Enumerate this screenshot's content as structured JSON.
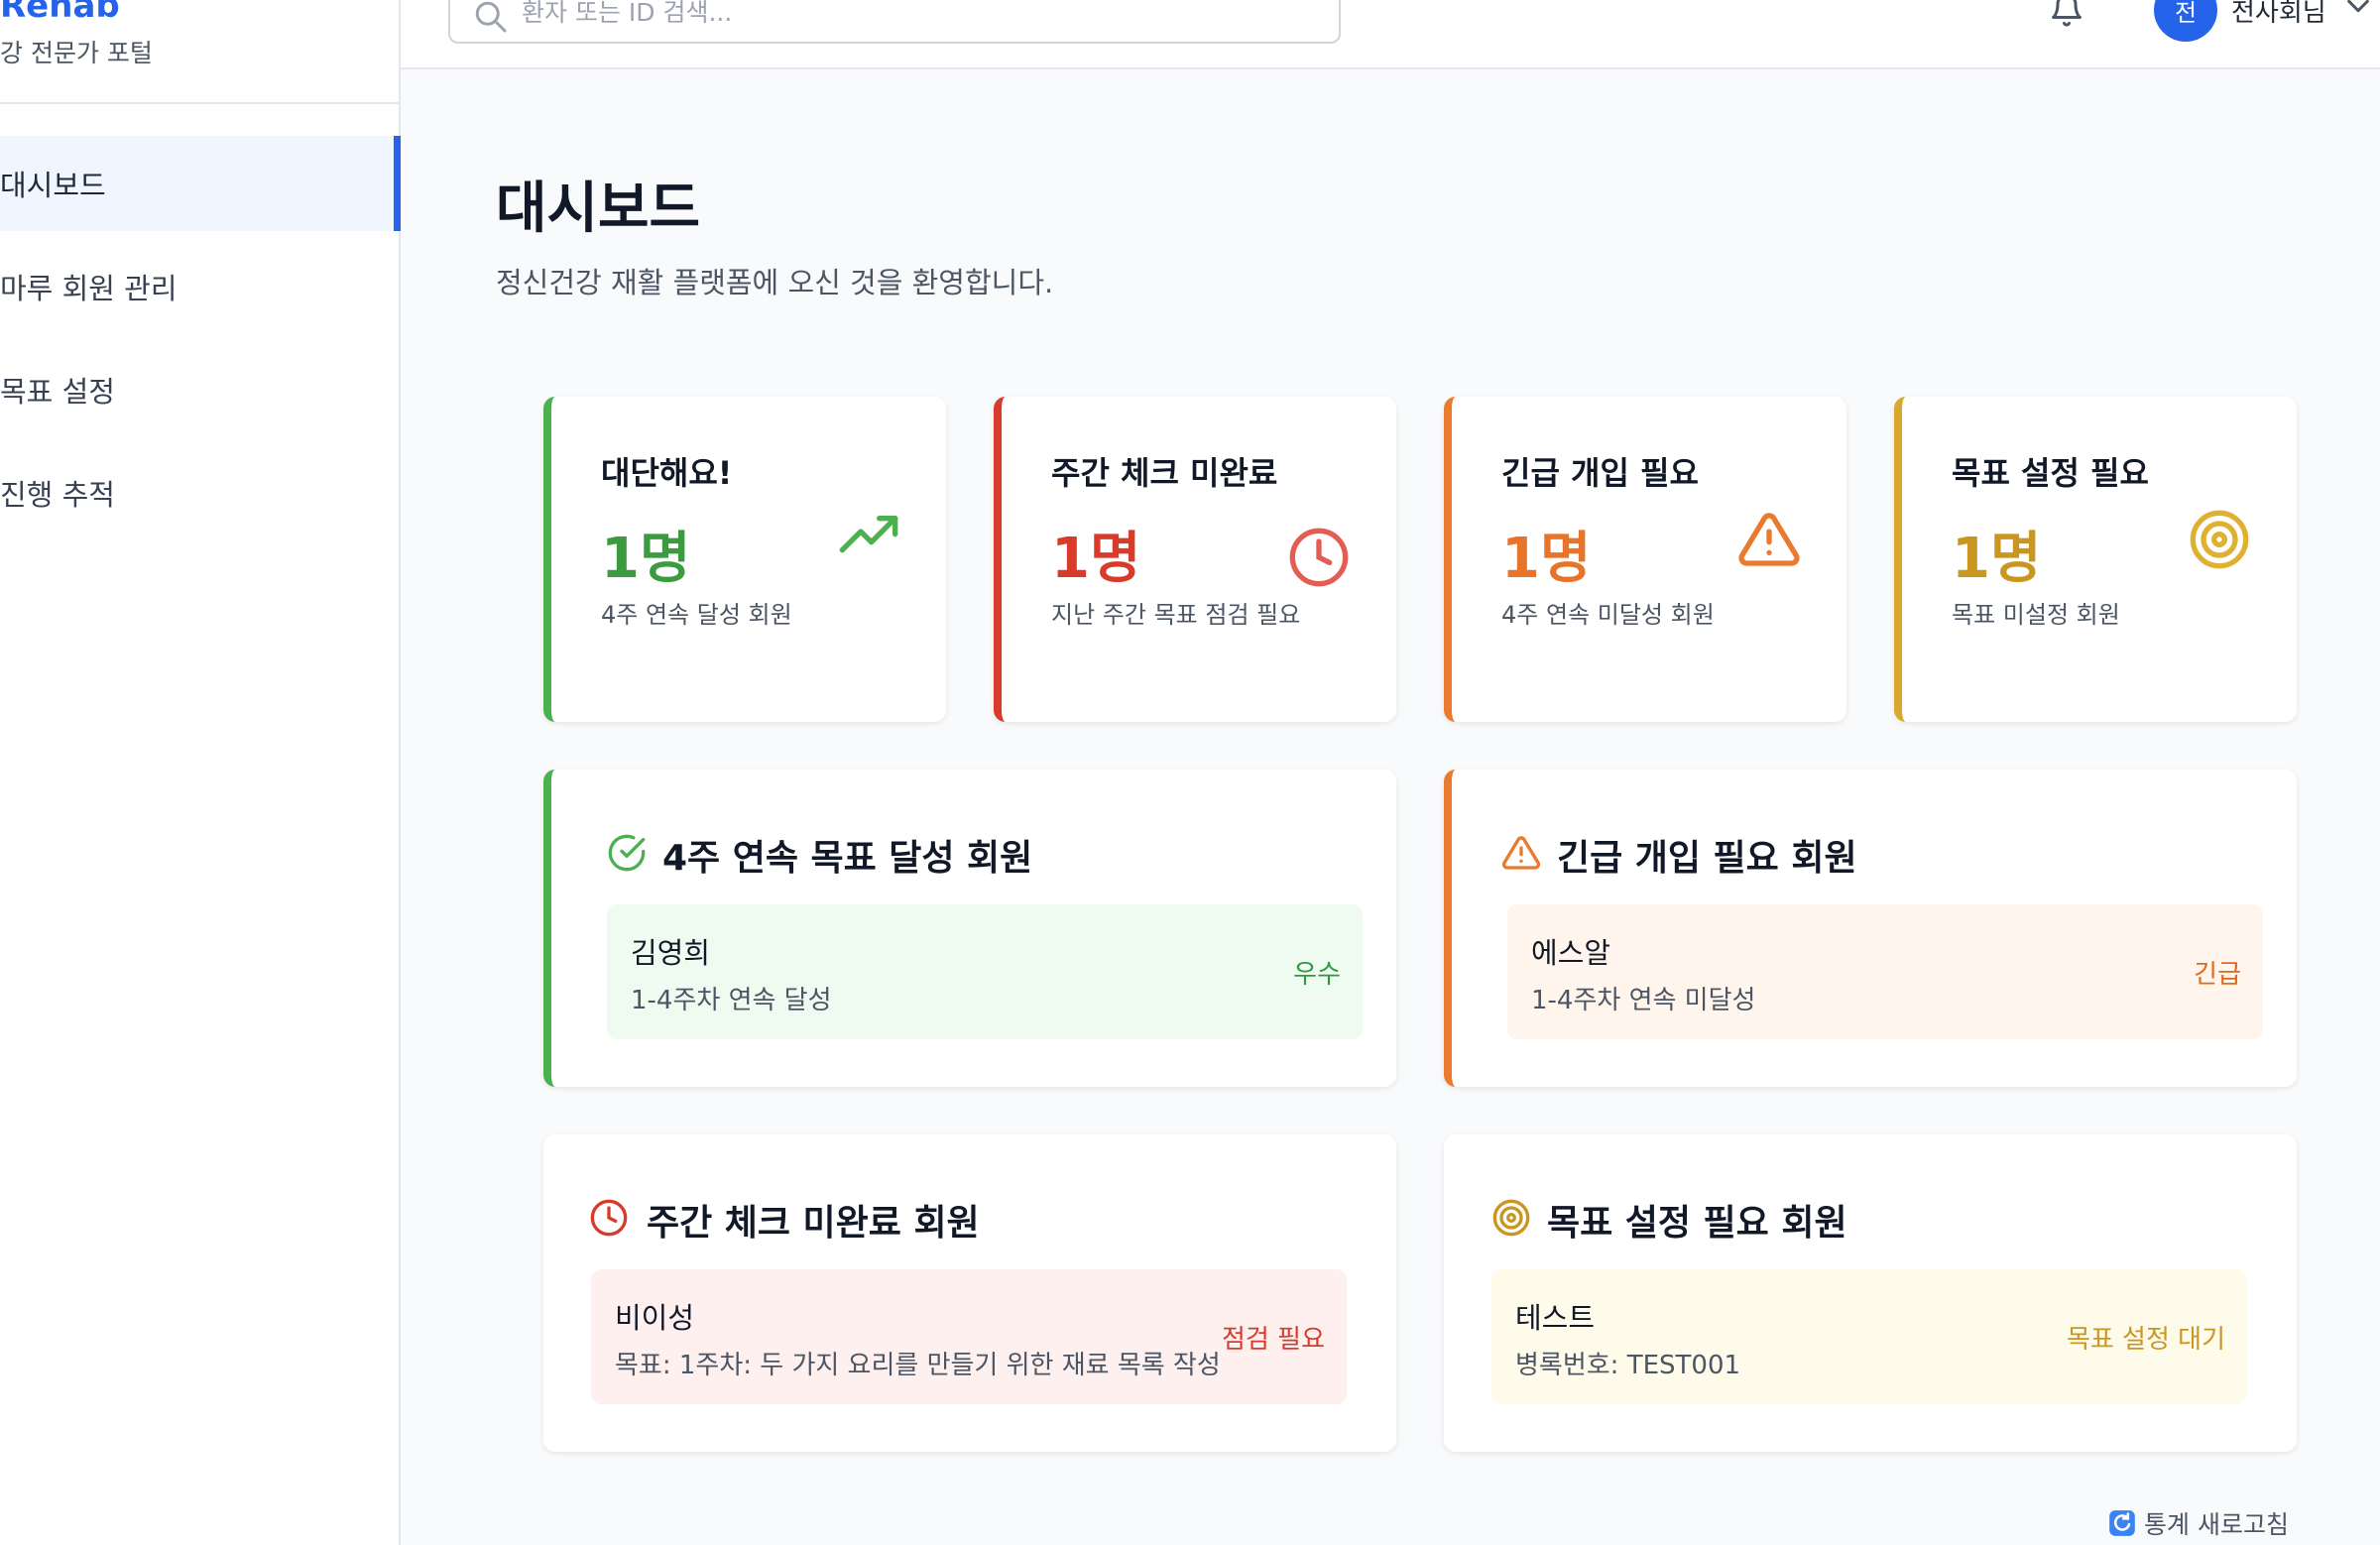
{
  "brand": {
    "name": "Rehab",
    "subtitle": "강 전문가 포털"
  },
  "sidebar": {
    "items": [
      {
        "label": "대시보드",
        "active": true
      },
      {
        "label": "마루 회원 관리"
      },
      {
        "label": "목표 설정"
      },
      {
        "label": "진행 추적"
      }
    ]
  },
  "topbar": {
    "search_placeholder": "환자 또는 ID 검색...",
    "avatar_initial": "전",
    "user_name": "전사회님"
  },
  "page": {
    "title": "대시보드",
    "subtitle": "정신건강 재활 플랫폼에 오신 것을 환영합니다."
  },
  "stats": [
    {
      "title": "대단해요!",
      "value": "1명",
      "desc": "4주 연속 달성 회원",
      "color": "#4caf50",
      "icon": "trending-up-icon"
    },
    {
      "title": "주간 체크 미완료",
      "value": "1명",
      "desc": "지난 주간 목표 점검 필요",
      "color": "#d93b2b",
      "icon": "clock-icon"
    },
    {
      "title": "긴급 개입 필요",
      "value": "1명",
      "desc": "4주 연속 미달성 회원",
      "color": "#ea7a2e",
      "icon": "warning-icon"
    },
    {
      "title": "목표 설정 필요",
      "value": "1명",
      "desc": "목표 미설정 회원",
      "color": "#d9a82e",
      "icon": "target-icon"
    }
  ],
  "lists": {
    "achieved": {
      "title": "4주 연속 목표 달성 회원",
      "row": {
        "name": "김영희",
        "detail": "1-4주차 연속 달성",
        "badge": "우수"
      }
    },
    "urgent": {
      "title": "긴급 개입 필요 회원",
      "row": {
        "name": "에스알",
        "detail": "1-4주차 연속 미달성",
        "badge": "긴급"
      }
    },
    "weekly": {
      "title": "주간 체크 미완료 회원",
      "row": {
        "name": "비이성",
        "detail": "목표: 1주차: 두 가지 요리를 만들기 위한 재료 목록 작성",
        "badge": "점검 필요"
      }
    },
    "goal": {
      "title": "목표 설정 필요 회원",
      "row": {
        "name": "테스트",
        "detail": "병록번호: TEST001",
        "badge": "목표 설정 대기"
      }
    }
  },
  "refresh_label": "통계 새로고침"
}
